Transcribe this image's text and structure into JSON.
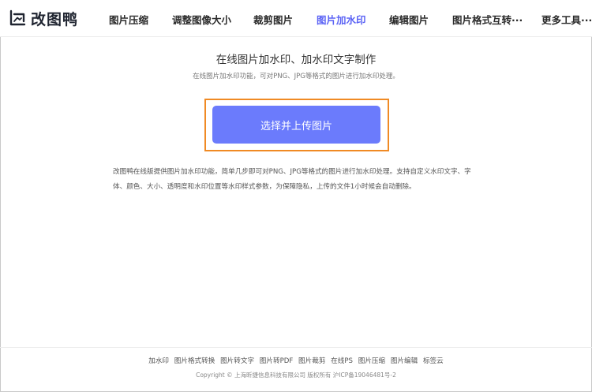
{
  "brand": {
    "logo_icon": "image-frame-icon",
    "name": "改图鸭",
    "accent": "#5b63f5"
  },
  "nav": {
    "items": [
      {
        "label": "图片压缩"
      },
      {
        "label": "调整图像大小"
      },
      {
        "label": "裁剪图片"
      },
      {
        "label": "图片加水印",
        "active": true
      },
      {
        "label": "编辑图片"
      },
      {
        "label": "图片格式互转···"
      },
      {
        "label": "更多工具···"
      }
    ]
  },
  "main": {
    "title": "在线图片加水印、加水印文字制作",
    "subtitle": "在线图片加水印功能，可对PNG、JPG等格式的图片进行加水印处理。",
    "upload_button": "选择并上传图片",
    "upload_button_color": "#6b7bfc",
    "highlight_color": "#f08a24",
    "description": "改图鸭在线版提供图片加水印功能，简单几步即可对PNG、JPG等格式的图片进行加水印处理。支持自定义水印文字、字体、颜色、大小、透明度和水印位置等水印样式参数，为保障隐私，上传的文件1小时候会自动删除。"
  },
  "footer": {
    "links": [
      "加水印",
      "图片格式转换",
      "图片转文字",
      "图片转PDF",
      "图片裁剪",
      "在线PS",
      "图片压缩",
      "图片编辑",
      "标签云"
    ],
    "copyright": "Copyright © 上海昕捷信息科技有限公司 版权所有 沪ICP备19046481号-2"
  }
}
